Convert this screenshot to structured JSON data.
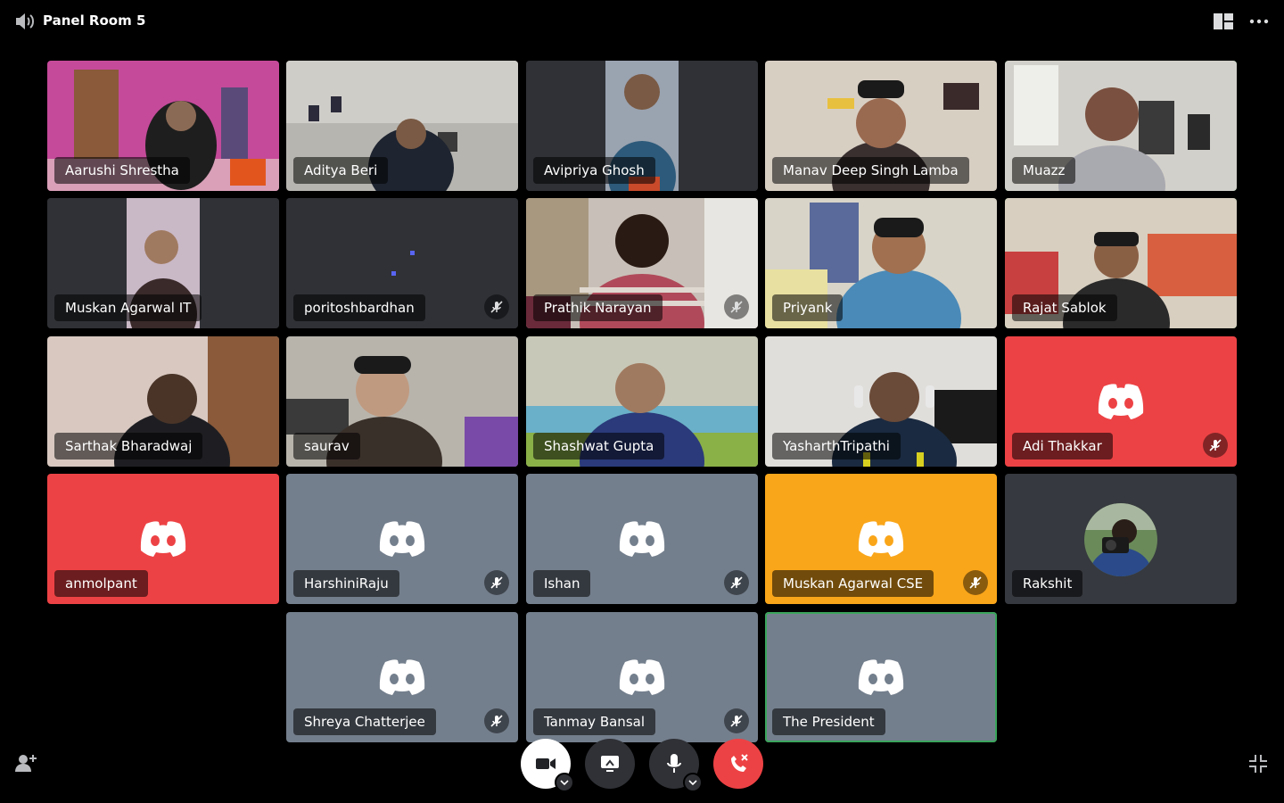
{
  "header": {
    "title": "Panel Room 5"
  },
  "participants": [
    {
      "name": "Aarushi Shrestha",
      "muted": false,
      "speaking": false
    },
    {
      "name": "Aditya Beri",
      "muted": false,
      "speaking": false
    },
    {
      "name": "Avipriya Ghosh",
      "muted": false,
      "speaking": false
    },
    {
      "name": "Manav Deep Singh Lamba",
      "muted": false,
      "speaking": false
    },
    {
      "name": "Muazz",
      "muted": false,
      "speaking": true
    },
    {
      "name": "Muskan Agarwal IT",
      "muted": false,
      "speaking": false
    },
    {
      "name": "poritoshbardhan",
      "muted": true,
      "speaking": false
    },
    {
      "name": "Prathik Narayan",
      "muted": true,
      "speaking": false
    },
    {
      "name": "Priyank",
      "muted": false,
      "speaking": false
    },
    {
      "name": "Rajat Sablok",
      "muted": false,
      "speaking": true
    },
    {
      "name": "Sarthak Bharadwaj",
      "muted": false,
      "speaking": false
    },
    {
      "name": "saurav",
      "muted": false,
      "speaking": false
    },
    {
      "name": "Shashwat Gupta",
      "muted": false,
      "speaking": false
    },
    {
      "name": "YasharthTripathi",
      "muted": false,
      "speaking": false
    },
    {
      "name": "Adi Thakkar",
      "muted": true,
      "speaking": false
    },
    {
      "name": "anmolpant",
      "muted": false,
      "speaking": false
    },
    {
      "name": "HarshiniRaju",
      "muted": true,
      "speaking": false
    },
    {
      "name": "Ishan",
      "muted": true,
      "speaking": false
    },
    {
      "name": "Muskan Agarwal CSE",
      "muted": true,
      "speaking": false
    },
    {
      "name": "Rakshit",
      "muted": false,
      "speaking": false
    },
    {
      "name": "Shreya Chatterjee",
      "muted": true,
      "speaking": false
    },
    {
      "name": "Tanmay Bansal",
      "muted": true,
      "speaking": false
    },
    {
      "name": "The President",
      "muted": false,
      "speaking": true
    }
  ],
  "colors": {
    "speaking_ring": "#3ba55c",
    "red_tile": "#ed4245",
    "yellow_tile": "#faa61a",
    "grey_tile": "#747f8d",
    "dark_tile": "#36393f",
    "end_call": "#ed4245"
  },
  "controls": {
    "camera": "video-camera-icon",
    "screen_share": "screen-share-icon",
    "microphone": "microphone-icon",
    "disconnect": "end-call-icon"
  }
}
